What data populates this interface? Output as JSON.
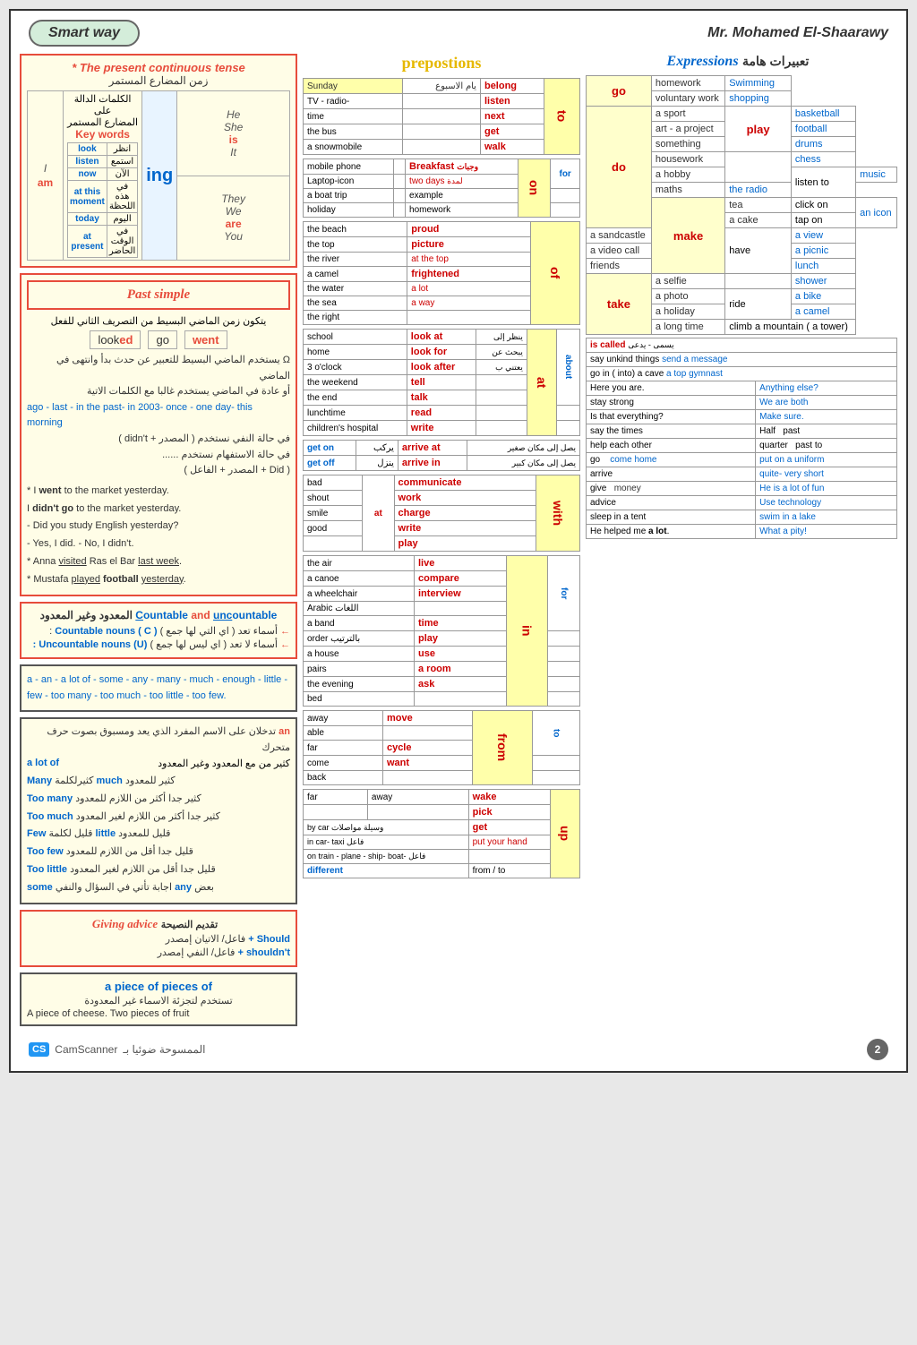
{
  "header": {
    "left": "Smart way",
    "right": "Mr. Mohamed El-Shaarawy"
  },
  "present_continuous": {
    "title": "* The present continuous tense",
    "arabic": "زمن المضارع المستمر",
    "keywords_title_ar": "الكلمات الدالة على",
    "keywords_title_ar2": "المضارع المستمر",
    "keywords_en": "Key words",
    "subjects": [
      {
        "sub": "I",
        "verb": "am"
      },
      {
        "sub": "He",
        "verb": ""
      },
      {
        "sub": "She",
        "verb": "is"
      },
      {
        "sub": "It",
        "verb": ""
      },
      {
        "sub": "They",
        "verb": ""
      },
      {
        "sub": "We",
        "verb": "are"
      },
      {
        "sub": "You",
        "verb": ""
      }
    ],
    "ing": "ing",
    "key_words": [
      {
        "en": "look",
        "ar": "انظر"
      },
      {
        "en": "listen",
        "ar": "استمع"
      },
      {
        "en": "now",
        "ar": "الآن"
      },
      {
        "en": "at this moment",
        "ar": "في هذه اللحظة"
      },
      {
        "en": "today",
        "ar": "اليوم"
      },
      {
        "en": "at present",
        "ar": "في الوقت الحاضر"
      }
    ]
  },
  "past_simple": {
    "title": "Past simple",
    "subtitle": "يتكون زمن الماضي البسيط من التصريف الثاني للفعل",
    "verbs": [
      {
        "base": "look",
        "past": "look",
        "ed": "ed"
      },
      {
        "base": "go",
        "irreg": "went"
      }
    ],
    "notes_ar": "يستخدم الماضي البسيط للتعبير عن حدث بدأ وانتهى في الماضي",
    "notes_ar2": "أو عادة في الماضي يستخدم غالبا مع الكلمات الآتية",
    "time_words": "ago - last - in the past- in 2003- once - one day- this morning",
    "negative": "في حالة النفي نستخدم ( المصدر + didn't )",
    "question": "في حالة الاستفهام نستخدم ........",
    "did": "( Did + المصدر + الفاعل )",
    "examples": [
      "* I went to the market yesterday.",
      "I didn't go to the market yesterday.",
      "- Did you study English yesterday?",
      "- Yes, I did.    - No, I didn't.",
      "* Anna visited Ras el Bar last week.",
      "* Mustafa played football yesterday."
    ]
  },
  "countable": {
    "title_en": "Countable and uncountable",
    "title_ar": "المعدود وغير المعدود",
    "rows": [
      {
        "type": "Countable nouns ( C )",
        "ar": "أسماء تعد ( اي التي لها جمع )"
      },
      {
        "type": "Uncountable nouns (U)",
        "ar": "أسماء لا تعد ( اي ليس لها جمع )"
      }
    ]
  },
  "articles": {
    "text": "a - an - a lot of - some - any - many - much - enough - little - few - too many - too much - too little - too few."
  },
  "usage": {
    "label_an": "an",
    "desc_an": "تدخلان على الاسم المفرد الذي يعد ومسبوق بصوت حرف متحرك",
    "a_lot_of_en": "a lot of",
    "a_lot_of_ar": "كثير من مع المعدود وغير المعدود",
    "quantifiers": [
      {
        "qt": "Many",
        "ar": "كثيرلكلمة",
        "qt2": "much",
        "ar2": "كثير للمعدود"
      },
      {
        "qt": "Too many",
        "ar": "كثير جدا أكثر من اللازم للمعدود"
      },
      {
        "qt": "Too much",
        "ar": "كثير جدا أكثر من اللازم لغير المعدود"
      },
      {
        "qt": "Few",
        "ar": "قليل لكلمة",
        "qt2": "little",
        "ar2": "قليل للمعدود"
      },
      {
        "qt": "Too few",
        "ar": "قليل جدا أقل من اللازم للمعدود"
      },
      {
        "qt": "Too little",
        "ar": "قليل جدا أقل من اللازم لغير المعدود"
      },
      {
        "qt": "some",
        "ar": "اجابة تأتي في السؤال والنفي",
        "qt2": "any",
        "ar2": "بعض"
      }
    ]
  },
  "giving_advice": {
    "title_en": "Giving advice",
    "title_ar": "تقديم النصيحة",
    "rows": [
      {
        "prefix": "Should +",
        "ar": "فاعل/ + الاتيان إمصدر"
      },
      {
        "prefix": "shouldn't +",
        "ar": "فاعل/ + النفي إمصدر"
      }
    ]
  },
  "piece_of": {
    "title": "a piece of    pieces of",
    "arabic": "تستخدم لتجزئة الاسماء غير المعدودة",
    "example": "A piece of cheese. Two pieces of fruit"
  },
  "prepositions": {
    "title": "prepostions",
    "sections": [
      {
        "prep": "to",
        "items": [
          {
            "en": "Sunday",
            "ar": "يام الاسبوع",
            "keyword": "belong"
          },
          {
            "en": "TV - radio-",
            "keyword": "listen"
          },
          {
            "en": "time",
            "keyword": "next"
          },
          {
            "en": "the bus",
            "keyword": "get"
          },
          {
            "en": "a snowmobile",
            "keyword": "walk"
          }
        ]
      },
      {
        "prep": "on",
        "items": [
          {
            "en": "mobile phone",
            "keyword": "Breakfast",
            "ar2": "وجبات"
          },
          {
            "en": "Laptop-icon",
            "keyword": "two days",
            "ar2": "لمدة"
          },
          {
            "en": "a boat trip",
            "keyword": "for",
            "sub": "example"
          },
          {
            "en": "holiday",
            "keyword": "homework"
          }
        ]
      },
      {
        "prep": "of",
        "items": [
          {
            "en": "the beach",
            "keyword": "proud"
          },
          {
            "en": "the top",
            "keyword": "picture"
          },
          {
            "en": "the river",
            "keyword": "at the top"
          },
          {
            "en": "a camel",
            "keyword": "frightened"
          },
          {
            "en": "the water",
            "keyword": "a lot"
          },
          {
            "en": "the sea",
            "keyword": "a way"
          },
          {
            "en": "the right",
            "keyword": ""
          }
        ]
      },
      {
        "prep": "at",
        "items": [
          {
            "en": "school",
            "keyword": "look at",
            "ar": "ينظر إلى"
          },
          {
            "en": "home",
            "keyword": "look for",
            "ar": "يبحث عن"
          },
          {
            "en": "3 o'clock",
            "keyword": "look after",
            "ar": "يعتني ب"
          },
          {
            "en": "the weekend",
            "keyword": "tell"
          },
          {
            "en": "the end",
            "keyword": "talk"
          },
          {
            "en": "lunchtime",
            "keyword": "read",
            "sub": "about"
          },
          {
            "en": "children's hospital",
            "keyword": "write"
          }
        ]
      },
      {
        "prep": "get on / get off",
        "items": [
          {
            "en": "get on",
            "ar": "يركب",
            "keyword": "arrive at",
            "ar2": "يصل إلى مكان صغير"
          },
          {
            "en": "get off",
            "ar": "ينزل",
            "keyword": "arrive in",
            "ar2": "يصل إلى مكان كبير"
          }
        ]
      },
      {
        "prep": "with",
        "items": [
          {
            "en": "bad",
            "keyword": "communicate"
          },
          {
            "en": "shout",
            "keyword": "work"
          },
          {
            "en": "smile",
            "keyword": "charge"
          },
          {
            "en": "good",
            "keyword": "write"
          },
          {
            "en": "",
            "keyword": "play"
          }
        ]
      },
      {
        "prep": "",
        "items": [
          {
            "en": "the air",
            "keyword": "live"
          },
          {
            "en": "a canoe",
            "keyword": "compare"
          },
          {
            "en": "a wheelchair",
            "keyword": "interview"
          },
          {
            "en": "Arabic اللغات",
            "keyword": ""
          }
        ]
      },
      {
        "prep": "in",
        "items": [
          {
            "en": "a band",
            "keyword": "time"
          },
          {
            "en": "order بالترتيب",
            "keyword": "play"
          },
          {
            "en": "a house",
            "keyword": "use",
            "sub": "for"
          },
          {
            "en": "pairs",
            "keyword": "a room"
          },
          {
            "en": "the evening",
            "keyword": "ask"
          },
          {
            "en": "bed",
            "keyword": ""
          }
        ]
      },
      {
        "prep": "from",
        "items": [
          {
            "en": "away",
            "keyword": "move"
          },
          {
            "en": "able",
            "keyword": ""
          },
          {
            "en": "far",
            "keyword": "cycle",
            "sub": "to"
          },
          {
            "en": "come",
            "keyword": "want"
          },
          {
            "en": "back",
            "keyword": ""
          }
        ]
      },
      {
        "prep": "up",
        "items": [
          {
            "en": "far",
            "keyword": "away",
            "sub": "wake"
          },
          {
            "en": "",
            "keyword": "pick"
          },
          {
            "en": "by car وسيلة مواصلات",
            "keyword": "get"
          },
          {
            "en": "in car- taxi فاعل",
            "keyword": "put your hand"
          },
          {
            "en": "on train - plane - ship- boat- فاعل",
            "keyword": ""
          },
          {
            "en": "different",
            "keyword": "from to"
          }
        ]
      }
    ]
  },
  "expressions": {
    "title_en": "Expressions",
    "title_ar": "تعبيرات هامة",
    "go_items": [
      "Swimming",
      "shopping"
    ],
    "do_items": [
      "homework",
      "voluntary work",
      "a sport",
      "art - a project",
      "something",
      "housework",
      "a hobby",
      "maths"
    ],
    "play_items": [
      "basketball",
      "football",
      "drums",
      "chess"
    ],
    "listen_to_items": [
      "music",
      "the radio"
    ],
    "make_items": [
      "tea",
      "a cake",
      "a sandcastle",
      "a video call",
      "friends"
    ],
    "click_tap": [
      "click on",
      "tap on"
    ],
    "have_items": [
      "a view",
      "a picnic",
      "lunch",
      "shower"
    ],
    "take_items": [
      "a selfie",
      "a photo",
      "a holiday",
      "a long time"
    ],
    "ride_items": [
      "a bike",
      "a camel"
    ],
    "phrases": [
      {
        "en": "is called",
        "ar": "يسمى - يدعى"
      },
      {
        "en": "climb a mountain ( a tower)",
        "ar": ""
      },
      {
        "en": "say unkind things",
        "ar": "send a message"
      },
      {
        "en": "go in ( into) a cave",
        "ar": "a top gymnast"
      },
      {
        "en": "Here you are.",
        "ar": "Anything else?"
      },
      {
        "en": "stay strong",
        "ar": "We are both"
      },
      {
        "en": "Is that everything?",
        "ar": "Make sure."
      },
      {
        "en": "say the times",
        "ar2": "Half",
        "ar3": "past"
      },
      {
        "en": "help each other",
        "ar2": "quarter",
        "ar3": "past to"
      },
      {
        "en": "go",
        "ar": "come home",
        "ar2": "put on a uniform"
      },
      {
        "en": "arrive",
        "ar": "quite- very short"
      },
      {
        "en": "give",
        "ar2": "money",
        "ar3": "He is a lot of fun"
      },
      {
        "en": "",
        "ar2": "advice",
        "ar3": "Use technology"
      },
      {
        "en": "sleep in a tent",
        "ar": "swim in a lake"
      },
      {
        "en": "He helped me a lot.",
        "ar": "What a pity!"
      }
    ]
  },
  "footer": {
    "camscanner": "CS CamScanner",
    "arabic": "الممسوحة ضوئيا بـ",
    "page": "2"
  }
}
